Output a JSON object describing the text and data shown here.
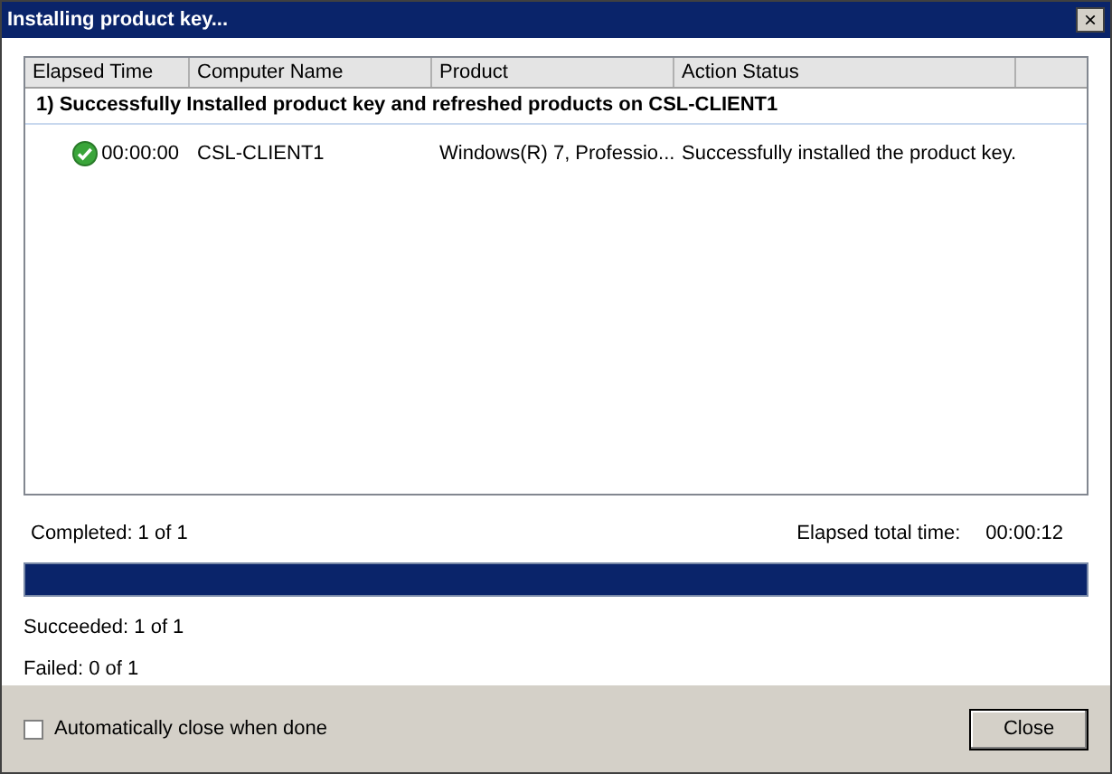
{
  "window": {
    "title": "Installing product key...",
    "close_glyph": "×"
  },
  "table": {
    "columns": [
      "Elapsed Time",
      "Computer Name",
      "Product",
      "Action Status"
    ],
    "groups": [
      {
        "title": "1) Successfully Installed  product key and refreshed products on CSL-CLIENT1",
        "rows": [
          {
            "kind": "success",
            "cells": [
              "00:00:00",
              "CSL-CLIENT1",
              "Windows(R) 7, Professio...",
              "Successfully installed the product key."
            ]
          }
        ]
      }
    ]
  },
  "progress": {
    "completed": "Completed: 1 of 1",
    "elapsed_label": "Elapsed total time:",
    "elapsed_value": "00:00:12",
    "level": 1
  },
  "summary": [
    "Succeeded: 1 of 1",
    "Failed: 0 of 1"
  ],
  "footer": {
    "auto_close": {
      "label": "Automatically close when done",
      "checked": false
    },
    "buttons": [
      "Close"
    ]
  }
}
